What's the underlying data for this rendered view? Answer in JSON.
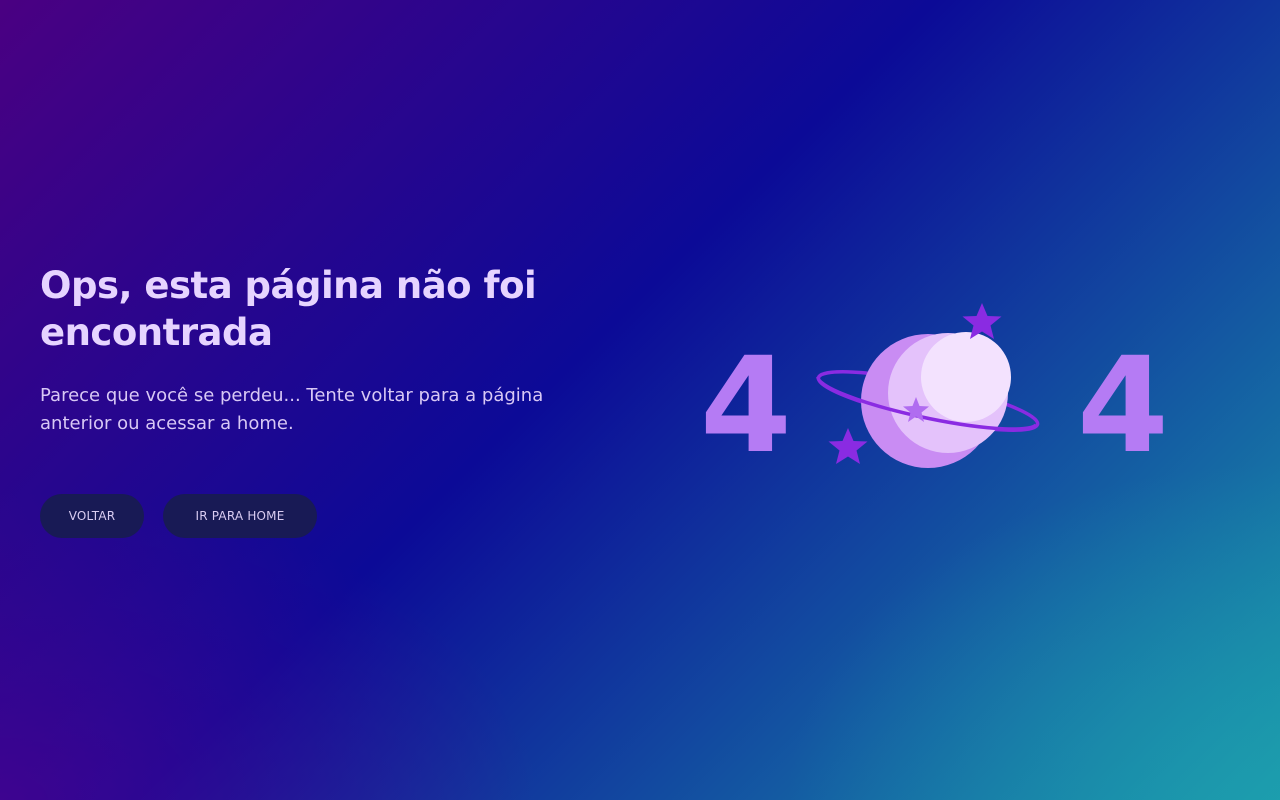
{
  "page": {
    "title": "Ops, esta página não foi encontrada",
    "subtitle": "Parece que você se perdeu... Tente voltar para a página anterior ou acessar a home."
  },
  "buttons": {
    "back_label": "VOLTAR",
    "home_label": "IR PARA HOME"
  },
  "illustration": {
    "left_digit": "4",
    "right_digit": "4",
    "icons": [
      "planet-icon",
      "star-icon"
    ]
  },
  "colors": {
    "bg_start": "#4a0082",
    "bg_mid": "#0c0a97",
    "bg_end": "#1a9aab",
    "title": "#e6d4ff",
    "button_bg": "#181a55",
    "digit": "#b57bf4",
    "accent_star": "#8a2be2"
  }
}
